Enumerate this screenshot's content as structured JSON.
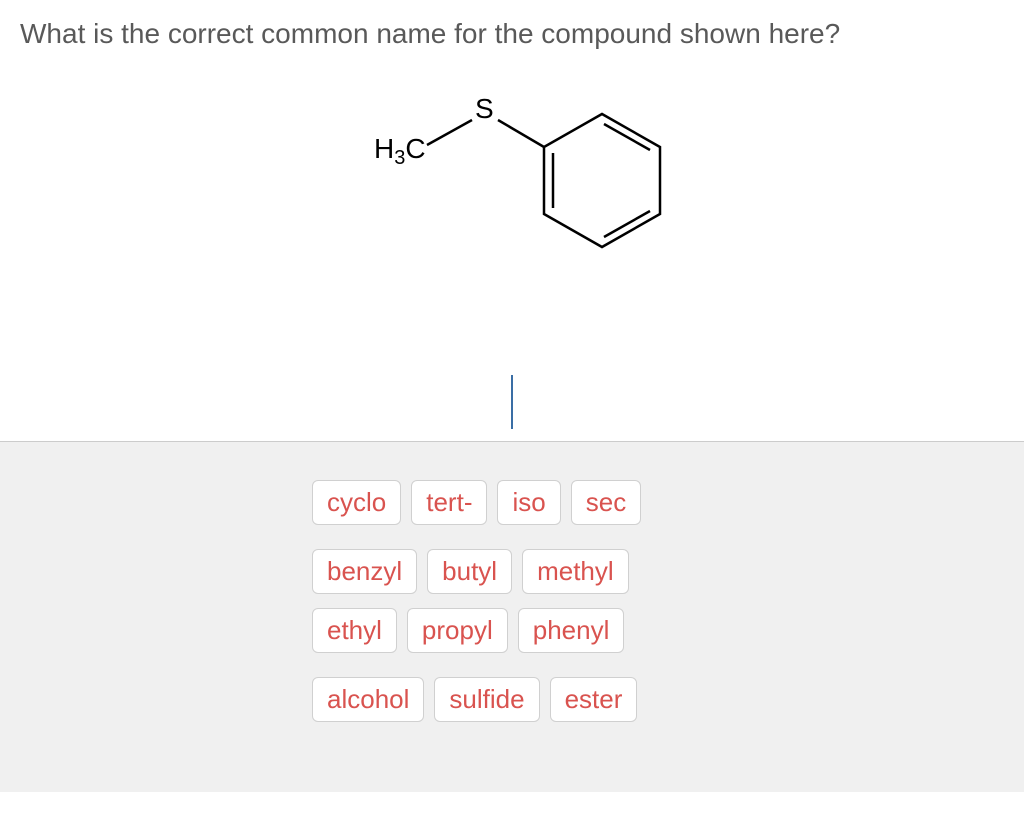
{
  "question": "What is the correct common name for the compound shown here?",
  "structure": {
    "labels": {
      "h3c": "H",
      "h3c_sub": "3",
      "h3c_c": "C",
      "s": "S"
    }
  },
  "options": {
    "row1": [
      "cyclo",
      "tert-",
      "iso",
      "sec"
    ],
    "row2": [
      "benzyl",
      "butyl",
      "methyl"
    ],
    "row3": [
      "ethyl",
      "propyl",
      "phenyl"
    ],
    "row4": [
      "alcohol",
      "sulfide",
      "ester"
    ]
  }
}
